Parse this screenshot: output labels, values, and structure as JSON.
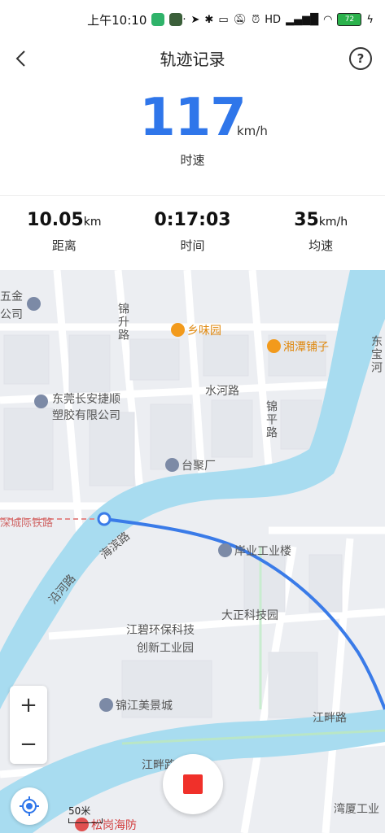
{
  "status_bar": {
    "time": "上午10:10",
    "battery": "72"
  },
  "header": {
    "title": "轨迹记录"
  },
  "speed": {
    "value": "117",
    "unit": "km/h",
    "label": "时速"
  },
  "stats": {
    "distance_value": "10.05",
    "distance_unit": "km",
    "distance_label": "距离",
    "time_value": "0:17:03",
    "time_label": "时间",
    "avg_value": "35",
    "avg_unit": "km/h",
    "avg_label": "均速"
  },
  "map": {
    "labels": {
      "wujin": "五金",
      "gongsi": "公司",
      "jinsheng": "锦升路",
      "xiangwei": "乡味园",
      "xiangtan": "湘潭铺子",
      "dongbao": "东宝河",
      "shuihe": "水河路",
      "dongguan_1": "东莞长安捷顺",
      "dongguan_2": "塑胶有限公司",
      "jinping": "锦平路",
      "taiju": "台聚厂",
      "shencheng": "深城际铁路",
      "haibin": "海滨路",
      "yanhe": "沿河路",
      "anye": "岸业工业楼",
      "dazheng": "大正科技园",
      "jiangbi_1": "江碧环保科技",
      "jiangbi_2": "创新工业园",
      "jinjiang": "锦江美景城",
      "jiangpan_1": "江畔路",
      "jiangpan_2": "江畔路",
      "wanxia": "湾厦工业",
      "songgang": "松岗海防"
    },
    "scale_label": "50米"
  },
  "colors": {
    "accent": "#2f76ea",
    "river": "#a8dcf0",
    "stop": "#f0302a",
    "road": "#ffffff",
    "poi_orange": "#f29a1c",
    "poi_blue": "#7c8aa6"
  }
}
